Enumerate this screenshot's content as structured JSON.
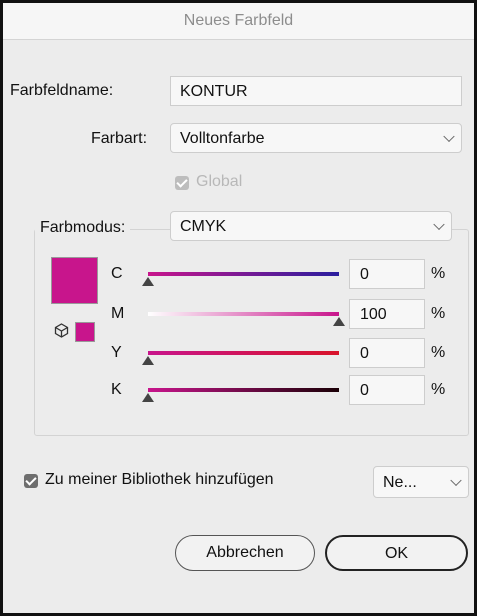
{
  "window": {
    "title": "Neues Farbfeld"
  },
  "swatch_name": {
    "label": "Farbfeldname:",
    "value": "KONTUR"
  },
  "color_type": {
    "label": "Farbart:",
    "value": "Volltonfarbe"
  },
  "global": {
    "label": "Global",
    "checked": true,
    "enabled": false
  },
  "color_mode": {
    "label": "Farbmodus:",
    "value": "CMYK"
  },
  "color_preview": {
    "color": "#c8158c"
  },
  "sliders": [
    {
      "label": "C",
      "value": "0",
      "unit": "%",
      "fraction": 0.0,
      "gradient": [
        "#c8158c",
        "#2a1e9e"
      ]
    },
    {
      "label": "M",
      "value": "100",
      "unit": "%",
      "fraction": 1.0,
      "gradient": [
        "#ffffff",
        "#c8158c"
      ]
    },
    {
      "label": "Y",
      "value": "0",
      "unit": "%",
      "fraction": 0.0,
      "gradient": [
        "#c8158c",
        "#d8142a"
      ]
    },
    {
      "label": "K",
      "value": "0",
      "unit": "%",
      "fraction": 0.0,
      "gradient": [
        "#c8158c",
        "#1a0006"
      ]
    }
  ],
  "add_to_library": {
    "label": "Zu meiner Bibliothek hinzufügen",
    "checked": true,
    "library_value": "Ne..."
  },
  "buttons": {
    "cancel": "Abbrechen",
    "ok": "OK"
  },
  "colors": {
    "accent": "#c8158c",
    "checkbox_on": "#6e6e6e",
    "checkbox_disabled": "#bdbdbd"
  }
}
